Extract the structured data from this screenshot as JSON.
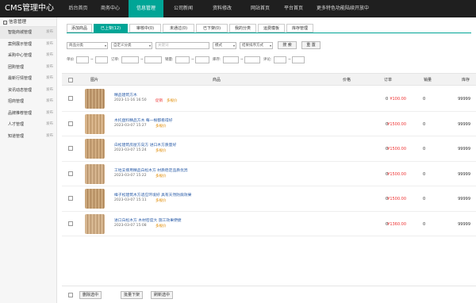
{
  "app_title": "CMS管理中心",
  "nav": [
    "后台首页",
    "商务中心",
    "信息管理",
    "公司新闻",
    "资料修改",
    "网站首页",
    "平台首页",
    "更多特色功能陆续开放中"
  ],
  "sidebar": {
    "header": "信息管理",
    "items": [
      {
        "label": "智能商城管理",
        "right": "发布"
      },
      {
        "label": "案例展示管理",
        "right": "发布"
      },
      {
        "label": "采购中心管理",
        "right": "发布"
      },
      {
        "label": "团购管理",
        "right": "发布"
      },
      {
        "label": "最新行情管理",
        "right": "发布"
      },
      {
        "label": "资讯动态管理",
        "right": "发布"
      },
      {
        "label": "招商管理",
        "right": "发布"
      },
      {
        "label": "品牌推荐管理",
        "right": "发布"
      },
      {
        "label": "人才管理",
        "right": "发布"
      },
      {
        "label": "知道管理",
        "right": "发布"
      }
    ]
  },
  "tabs": [
    "添加商品",
    "已上架(12)",
    "审核中(0)",
    "未通过(0)",
    "已下架(0)",
    "我的分类",
    "运费模板",
    "库存管理"
  ],
  "filters": {
    "category1": "商品分类",
    "category2": "自定义分类",
    "keyword_placeholder": "关键词",
    "mode": "模式",
    "sort": "结果排序方式",
    "search": "搜 索",
    "reset": "重 置",
    "price": "单价",
    "orders": "订单",
    "sales": "销量",
    "stock": "库存",
    "rating": "评论"
  },
  "table": {
    "headers": {
      "image": "图片",
      "product": "商品",
      "price": "价格",
      "orders": "订单",
      "sales": "销量",
      "stock": "库存"
    },
    "rows": [
      {
        "title": "精品建筑方木",
        "date": "2023-11-16 16:50",
        "tag1": "促销",
        "tag2": "多规价",
        "price": "¥100.00",
        "orders": "0",
        "sales": "0",
        "stock": "99999"
      },
      {
        "title": "木托盘料精品方木 每一根都看得好",
        "date": "2023-03-07 15:27",
        "tag1": "",
        "tag2": "多规价",
        "price": "¥1500.00",
        "orders": "0",
        "sales": "0",
        "stock": "99999"
      },
      {
        "title": "白松建筑房屋方向方 进口木方质量好",
        "date": "2023-03-07 15:24",
        "tag1": "",
        "tag2": "多规价",
        "price": "¥1500.00",
        "orders": "0",
        "sales": "0",
        "stock": "99999"
      },
      {
        "title": "工地支撑用精品白松木方 材质稳定品质优异",
        "date": "2023-03-07 15:22",
        "tag1": "",
        "tag2": "多规价",
        "price": "¥1500.00",
        "orders": "0",
        "sales": "0",
        "stock": "99999"
      },
      {
        "title": "樟子松建筑木方适应环境好 具有天然防腐效果",
        "date": "2023-03-07 15:11",
        "tag1": "",
        "tag2": "多规价",
        "price": "¥1500.00",
        "orders": "0",
        "sales": "0",
        "stock": "99999"
      },
      {
        "title": "进口白松木方 木材密度大 施工效果便捷",
        "date": "2023-03-07 15:08",
        "tag1": "",
        "tag2": "多规价",
        "price": "¥1360.00",
        "orders": "0",
        "sales": "0",
        "stock": "99999"
      }
    ]
  },
  "footer": {
    "delete": "删除选中",
    "batch_off": "批量下架",
    "refresh": "刷新选中"
  },
  "colors": {
    "accent": "#00a596",
    "topbar": "#1f1f1f",
    "price": "#e33333",
    "promo": "#e33333",
    "multi": "#e08a00",
    "link": "#2a5ca8"
  }
}
